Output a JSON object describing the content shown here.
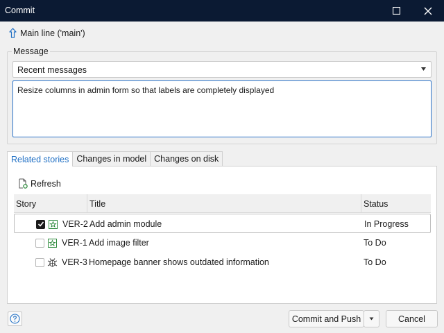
{
  "window": {
    "title": "Commit"
  },
  "branch": {
    "label": "Main line ('main')"
  },
  "message": {
    "legend": "Message",
    "recent_selected": "Recent messages",
    "text": "Resize columns in admin form so that labels are completely displayed"
  },
  "tabs": [
    {
      "label": "Related stories",
      "active": true
    },
    {
      "label": "Changes in model",
      "active": false
    },
    {
      "label": "Changes on disk",
      "active": false
    }
  ],
  "toolbar": {
    "refresh_label": "Refresh"
  },
  "grid": {
    "headers": {
      "story": "Story",
      "title": "Title",
      "status": "Status"
    },
    "rows": [
      {
        "checked": true,
        "icon": "story-icon",
        "id": "VER-2",
        "title": "Add admin module",
        "status": "In Progress"
      },
      {
        "checked": false,
        "icon": "story-icon",
        "id": "VER-1",
        "title": "Add image filter",
        "status": "To Do"
      },
      {
        "checked": false,
        "icon": "bug-icon",
        "id": "VER-3",
        "title": "Homepage banner shows outdated information",
        "status": "To Do"
      }
    ]
  },
  "buttons": {
    "commit": "Commit and Push",
    "cancel": "Cancel"
  },
  "colors": {
    "titlebar": "#0b1a33",
    "accent": "#1f6fc4",
    "story_icon": "#2e8b3d"
  }
}
